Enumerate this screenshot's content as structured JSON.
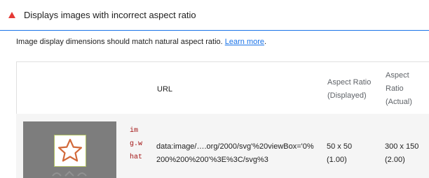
{
  "audit": {
    "title": "Displays images with incorrect aspect ratio",
    "status_color": "#e53935",
    "description": "Image display dimensions should match natural aspect ratio. ",
    "learn_more": "Learn more",
    "description_end": "."
  },
  "table": {
    "headers": {
      "url": "URL",
      "displayed_line1": "Aspect Ratio",
      "displayed_line2": "(Displayed)",
      "actual_line1": "Aspect",
      "actual_line2": "Ratio",
      "actual_line3": "(Actual)"
    },
    "rows": [
      {
        "thumbnail_icon": "star-icon",
        "node_label": "img.what",
        "url_line1": "data:image/….org/2000/svg'%20viewBox='0%",
        "url_line2": "200%200%200'%3E%3C/svg%3",
        "displayed_line1": "50 x 50",
        "displayed_line2": "(1.00)",
        "actual_line1": "300 x 150",
        "actual_line2": "(2.00)"
      }
    ]
  }
}
